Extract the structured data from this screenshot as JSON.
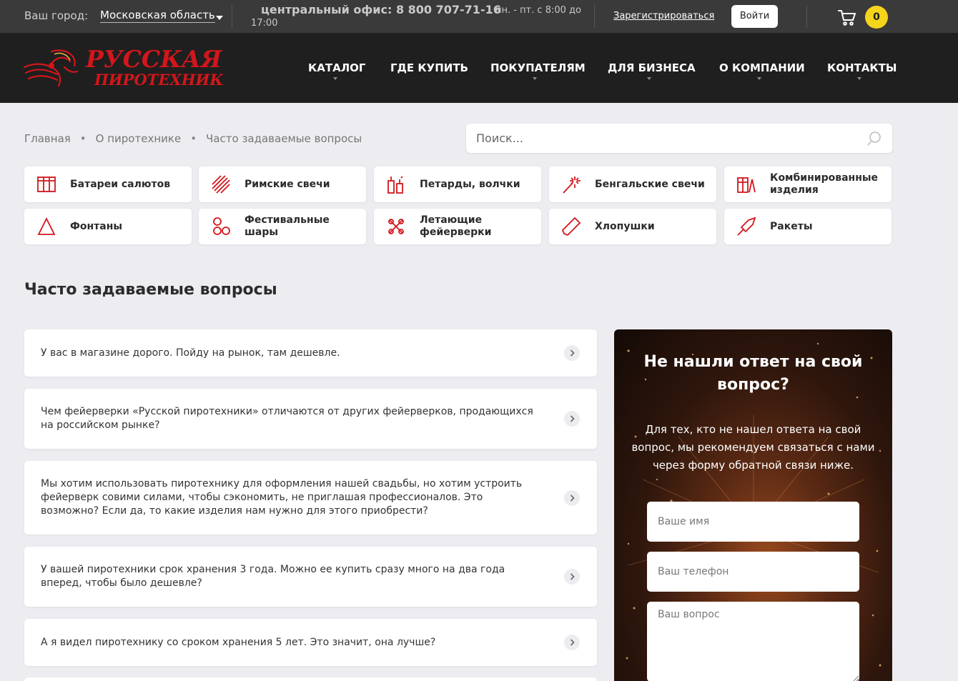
{
  "topbar": {
    "city_label": "Ваш город:",
    "city": "Московская область",
    "phone": "центральный офис: 8 800 707-71-16",
    "hours_part1": "пн. - пт. с 8:00 до",
    "hours_part2": "17:00",
    "register": "Зарегистрироваться",
    "login": "Войти",
    "cart_count": "0"
  },
  "brand": {
    "line1": "РУССКАЯ",
    "line2": "ПИРОТЕХНИКА",
    "color": "#d3161b"
  },
  "nav": [
    {
      "label": "КАТАЛОГ",
      "has_dropdown": true
    },
    {
      "label": "ГДЕ КУПИТЬ",
      "has_dropdown": false
    },
    {
      "label": "ПОКУПАТЕЛЯМ",
      "has_dropdown": true
    },
    {
      "label": "ДЛЯ БИЗНЕСА",
      "has_dropdown": true
    },
    {
      "label": "О КОМПАНИИ",
      "has_dropdown": true
    },
    {
      "label": "КОНТАКТЫ",
      "has_dropdown": true
    }
  ],
  "breadcrumb": [
    "Главная",
    "О пиротехнике",
    "Часто задаваемые вопросы"
  ],
  "search": {
    "placeholder": "Поиск..."
  },
  "categories": [
    {
      "label": "Батареи салютов",
      "icon": "battery-grid-icon"
    },
    {
      "label": "Римские свечи",
      "icon": "roman-candles-icon"
    },
    {
      "label": "Петарды, волчки",
      "icon": "firecrackers-icon"
    },
    {
      "label": "Бенгальские свечи",
      "icon": "sparkler-icon"
    },
    {
      "label": "Комбинированные изделия",
      "icon": "combined-icon"
    },
    {
      "label": "Фонтаны",
      "icon": "fountain-icon"
    },
    {
      "label": "Фестивальные шары",
      "icon": "festival-balls-icon"
    },
    {
      "label": "Летающие фейерверки",
      "icon": "flying-fireworks-icon"
    },
    {
      "label": "Хлопушки",
      "icon": "party-popper-icon"
    },
    {
      "label": "Ракеты",
      "icon": "rocket-icon"
    }
  ],
  "page_title": "Часто задаваемые вопросы",
  "faq": [
    "У вас в магазине дорого. Пойду на рынок, там дешевле.",
    "Чем фейерверки «Русской пиротехники» отличаются от других фейерверков, продающихся на российском рынке?",
    "Мы хотим использовать пиротехнику для оформления нашей свадьбы, но хотим устроить фейерверк совими силами, чтобы сэкономить, не приглашая профессионалов. Это возможно? Если да, то какие изделия нам нужно для этого приобрести?",
    "У вашей пиротехники срок хранения 3 года. Можно ее купить сразу много на два года вперед, чтобы было дешевле?",
    "А я видел пиротехнику со сроком хранения 5 лет. Это значит, она лучше?"
  ],
  "contact_panel": {
    "title": "Не нашли ответ на свой вопрос?",
    "text": "Для тех, кто не нашел ответа на свой вопрос, мы рекомендуем связаться с нами через форму обратной связи ниже.",
    "name_placeholder": "Ваше имя",
    "phone_placeholder": "Ваш телефон",
    "question_placeholder": "Ваш вопрос"
  },
  "colors": {
    "accent_red": "#d3161b",
    "header_bg": "#1f1f1f",
    "topbar_bg": "#3a3a3a",
    "cart_badge": "#f5d41c",
    "page_bg": "#ececf1"
  }
}
